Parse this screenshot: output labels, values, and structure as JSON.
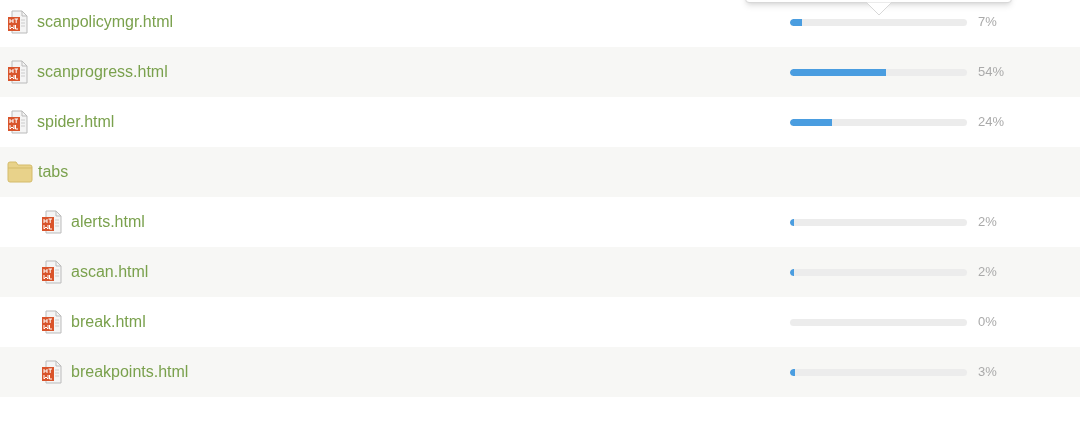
{
  "files": [
    {
      "kind": "file",
      "name": "scanpolicymgr.html",
      "level": 0.07,
      "percent": "7%"
    },
    {
      "kind": "file",
      "name": "scanprogress.html",
      "level": 0.54,
      "percent": "54%"
    },
    {
      "kind": "file",
      "name": "spider.html",
      "level": 0.24,
      "percent": "24%"
    },
    {
      "kind": "folder",
      "name": "tabs",
      "children": [
        {
          "kind": "file",
          "name": "alerts.html",
          "level": 0.02,
          "percent": "2%"
        },
        {
          "kind": "file",
          "name": "ascan.html",
          "level": 0.02,
          "percent": "2%"
        },
        {
          "kind": "file",
          "name": "break.html",
          "level": 0,
          "percent": "0%"
        },
        {
          "kind": "file",
          "name": "breakpoints.html",
          "level": 0.03,
          "percent": "3%"
        }
      ]
    }
  ]
}
